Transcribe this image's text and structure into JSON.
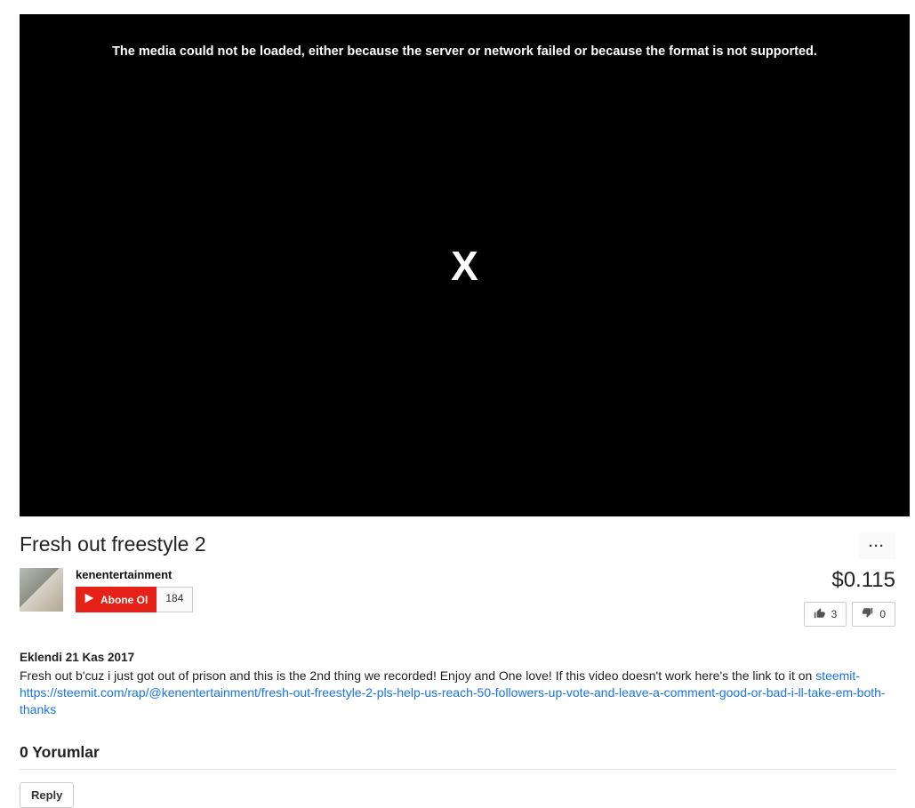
{
  "player": {
    "error_message": "The media could not be loaded, either because the server or network failed or because the format is not supported.",
    "center_mark": "X"
  },
  "video": {
    "title": "Fresh out freestyle 2",
    "channel": "kenentertainment",
    "subscribe_label": "Abone Ol",
    "subscriber_count": "184",
    "price": "$0.115",
    "likes": "3",
    "dislikes": "0",
    "date_label": "Eklendi 21 Kas 2017",
    "description_text": "Fresh out b'cuz i just got out of prison and this is the 2nd thing we recorded! Enjoy and One love! If this video doesn't work here's the link to it on ",
    "description_link": "steemit- https://steemit.com/rap/@kenentertainment/fresh-out-freestyle-2-pls-help-us-reach-50-followers-up-vote-and-leave-a-comment-good-or-bad-i-ll-take-em-both-thanks"
  },
  "comments": {
    "header": "0 Yorumlar",
    "reply_label": "Reply"
  },
  "more_label": "···"
}
